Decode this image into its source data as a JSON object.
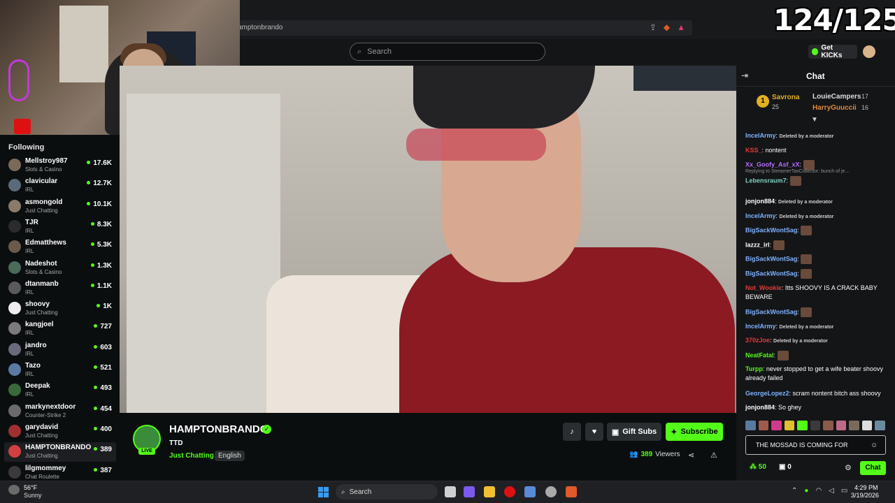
{
  "overlay": {
    "counter": "124/125"
  },
  "browser": {
    "url": "amptonbrando"
  },
  "header": {
    "search_placeholder": "Search",
    "get_kicks": "Get KICKs"
  },
  "sidebar": {
    "title": "Following",
    "items": [
      {
        "name": "Mellstroy987",
        "category": "Slots & Casino",
        "viewers": "17.6K"
      },
      {
        "name": "clavicular",
        "category": "IRL",
        "viewers": "12.7K"
      },
      {
        "name": "asmongold",
        "category": "Just Chatting",
        "viewers": "10.1K"
      },
      {
        "name": "TJR",
        "category": "IRL",
        "viewers": "8.3K"
      },
      {
        "name": "Edmatthews",
        "category": "IRL",
        "viewers": "5.3K"
      },
      {
        "name": "Nadeshot",
        "category": "Slots & Casino",
        "viewers": "1.3K"
      },
      {
        "name": "dtanmanb",
        "category": "IRL",
        "viewers": "1.1K"
      },
      {
        "name": "shoovy",
        "category": "Just Chatting",
        "viewers": "1K"
      },
      {
        "name": "kangjoel",
        "category": "IRL",
        "viewers": "727"
      },
      {
        "name": "jandro",
        "category": "IRL",
        "viewers": "603"
      },
      {
        "name": "Tazo",
        "category": "IRL",
        "viewers": "521"
      },
      {
        "name": "Deepak",
        "category": "IRL",
        "viewers": "493"
      },
      {
        "name": "markynextdoor",
        "category": "Counter-Strike 2",
        "viewers": "454"
      },
      {
        "name": "garydavid",
        "category": "Just Chatting",
        "viewers": "400"
      },
      {
        "name": "HAMPTONBRANDO",
        "category": "Just Chatting",
        "viewers": "389"
      },
      {
        "name": "lilgmommey",
        "category": "Chat Roulette",
        "viewers": "387"
      }
    ]
  },
  "channel": {
    "name": "HAMPTONBRANDO",
    "title": "TTD",
    "category": "Just Chatting",
    "language": "English",
    "live": "LIVE",
    "viewers": "389",
    "viewers_label": "Viewers",
    "gift_subs": "Gift Subs",
    "subscribe": "Subscribe"
  },
  "chat": {
    "title": "Chat",
    "leaderboard": {
      "rank": "1",
      "first": {
        "name": "Savrona",
        "count": "25"
      },
      "second": {
        "name": "LouieCampers",
        "count": "17"
      },
      "third": {
        "name": "HarryGuuccii",
        "count": "16"
      }
    },
    "messages": [
      {
        "user": "IncelArmy",
        "color": "#7fb2ff",
        "text": "Deleted by a moderator",
        "deleted": true
      },
      {
        "user": "KSS_",
        "color": "#e23b3b",
        "text": "nontent"
      },
      {
        "user": "Xx_Goofy_Asf_xX",
        "color": "#b56cff",
        "text": ""
      },
      {
        "reply": "Replying to StreamerTaxCollector: bunch of je...",
        "user": "Lebensraum7",
        "color": "#7fd0c0",
        "text": ""
      },
      {
        "user": "jonjon884",
        "color": "#ffffff",
        "text": "Deleted by a moderator",
        "deleted": true
      },
      {
        "user": "IncelArmy",
        "color": "#7fb2ff",
        "text": "Deleted by a moderator",
        "deleted": true
      },
      {
        "user": "BigSackWontSag",
        "color": "#7fb2ff",
        "text": ""
      },
      {
        "user": "lazzz_irl",
        "color": "#ffffff",
        "text": ""
      },
      {
        "user": "BigSackWontSag",
        "color": "#7fb2ff",
        "text": ""
      },
      {
        "user": "BigSackWontSag",
        "color": "#7fb2ff",
        "text": ""
      },
      {
        "user": "Not_Wookie",
        "color": "#e23b3b",
        "text": "Itts SHOOVY IS A CRACK BABY BEWARE"
      },
      {
        "user": "BigSackWontSag",
        "color": "#7fb2ff",
        "text": ""
      },
      {
        "user": "IncelArmy",
        "color": "#7fb2ff",
        "text": "Deleted by a moderator",
        "deleted": true
      },
      {
        "user": "370zJoe",
        "color": "#e23b3b",
        "text": "Deleted by a moderator",
        "deleted": true
      },
      {
        "user": "NeatFatal",
        "color": "#53fc18",
        "text": ""
      },
      {
        "user": "Turpp",
        "color": "#53fc18",
        "text": "never stopped to get a wife beater shoovy already failed"
      },
      {
        "user": "GeorgeLopez2",
        "color": "#7fb2ff",
        "text": "scram nontent bitch ass shoovy"
      },
      {
        "user": "jonjon884",
        "color": "#ffffff",
        "text": "So ghey"
      }
    ],
    "input_value": "THE MOSSAD IS COMING FOR",
    "kicks_count": "50",
    "gift_count": "0",
    "send": "Chat"
  },
  "taskbar": {
    "temp": "56°F",
    "weather": "Sunny",
    "search": "Search",
    "time": "4:29 PM",
    "date": "3/19/2026"
  },
  "colors": {
    "accent": "#53fc18",
    "bg": "#0b0e0f",
    "chat_bg": "#141517"
  }
}
